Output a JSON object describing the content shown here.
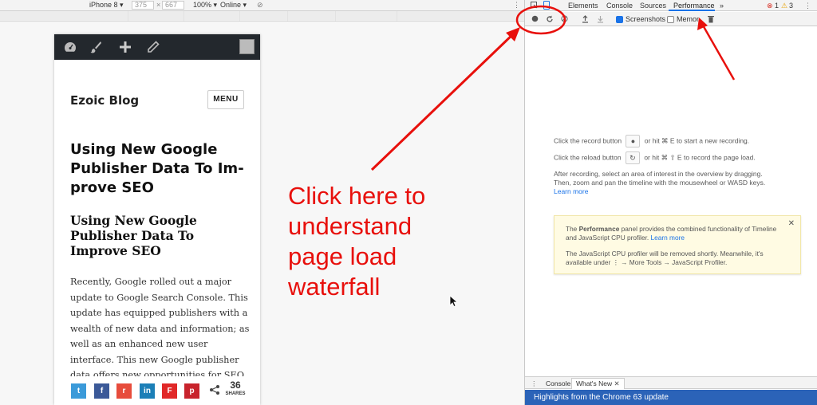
{
  "device_toolbar": {
    "device": "iPhone 8",
    "width": "375",
    "height": "667",
    "zoom": "100%",
    "network": "Online"
  },
  "phone": {
    "site_title": "Ezoic Blog",
    "menu_label": "MENU",
    "post_title": "Using New Google Publisher Data To Im-prove SEO",
    "post_subtitle": "Using New Google Publisher Data To Improve SEO",
    "body": "Recently, Google rolled out a major update to Google Search Console. This update has equipped publishers with a wealth of new data and information; as well as an enhanced new user interface. This new Google publisher data offers new opportunities for SEO and",
    "share_count": "36",
    "share_label": "SHARES",
    "share_buttons": [
      {
        "name": "twitter",
        "glyph": "t",
        "color": "#3b9ad9"
      },
      {
        "name": "facebook",
        "glyph": "f",
        "color": "#3b5998"
      },
      {
        "name": "reddit",
        "glyph": "r",
        "color": "#e74c3c"
      },
      {
        "name": "linkedin",
        "glyph": "in",
        "color": "#1c7fb7"
      },
      {
        "name": "flipboard",
        "glyph": "F",
        "color": "#e12828"
      },
      {
        "name": "pinterest",
        "glyph": "p",
        "color": "#c8232c"
      }
    ]
  },
  "annotation": {
    "text": "Click here to understand page load waterfall",
    "color": "#e8100c"
  },
  "devtools": {
    "tabs": [
      "Elements",
      "Console",
      "Sources",
      "Performance"
    ],
    "more_tabs": "»",
    "error_count": "1",
    "warning_count": "3",
    "toolbar": {
      "screenshots_label": "Screenshots",
      "memory_label": "Memor"
    },
    "instructions": {
      "record_a": "Click the record button",
      "record_b": "or hit ⌘ E to start a new recording.",
      "reload_a": "Click the reload button",
      "reload_b": "or hit ⌘ ⇧ E to record the page load.",
      "after_line1": "After recording, select an area of interest in the overview by dragging.",
      "after_line2": "Then, zoom and pan the timeline with the mousewheel or WASD keys.",
      "learn_more": "Learn more"
    },
    "note": {
      "p1_a": "The ",
      "p1_bold": "Performance",
      "p1_b": " panel provides the combined functionality of Timeline and JavaScript CPU profiler.",
      "p1_link": "Learn more",
      "p2": "The JavaScript CPU profiler will be removed shortly. Meanwhile, it's available under ⋮ → More Tools → JavaScript Profiler."
    },
    "drawer": {
      "console_tab": "Console",
      "whatsnew_tab": "What's New"
    },
    "highlights": "Highlights from the Chrome 63 update"
  }
}
